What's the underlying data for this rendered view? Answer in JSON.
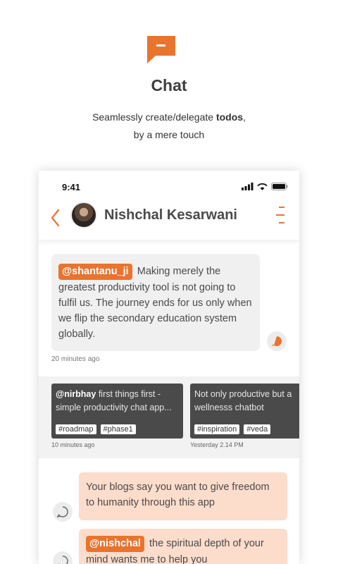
{
  "hero": {
    "title": "Chat",
    "subtitle_before": "Seamlessly create/delegate ",
    "subtitle_bold": "todos",
    "subtitle_after": ",",
    "subtitle_line2": "by a mere touch",
    "icon": "chat-bubble-icon"
  },
  "status_bar": {
    "time": "9:41"
  },
  "header": {
    "contact_name": "Nishchal Kesarwani"
  },
  "messages": {
    "incoming": {
      "mention": "@shantanu_ji",
      "text": "Making merely the greatest productivity tool is not going to fulfil us.  The journey ends for us only when we flip the secondary education system globally.",
      "timestamp": "20 minutes ago"
    },
    "cards": [
      {
        "mention": "@nirbhay",
        "line1": " first things first -",
        "line2": "simple productivity chat app...",
        "tags": [
          "#roadmap",
          "#phase1"
        ],
        "timestamp": "10 minutes ago"
      },
      {
        "line1": "Not only productive but a",
        "line2": "wellnesss chatbot",
        "tags": [
          "#inspiration",
          "#veda"
        ],
        "timestamp": "Yesterday  2.14 PM"
      }
    ],
    "outgoing": [
      {
        "text": "Your blogs say you want to give freedom to humanity through this app"
      },
      {
        "mention": "@nishchal",
        "text": " the spiritual depth of your mind wants me to help you"
      }
    ]
  },
  "colors": {
    "accent": "#e8742e",
    "outgoing_bubble": "#fcdccb",
    "card_bg": "#4a4a4a"
  }
}
